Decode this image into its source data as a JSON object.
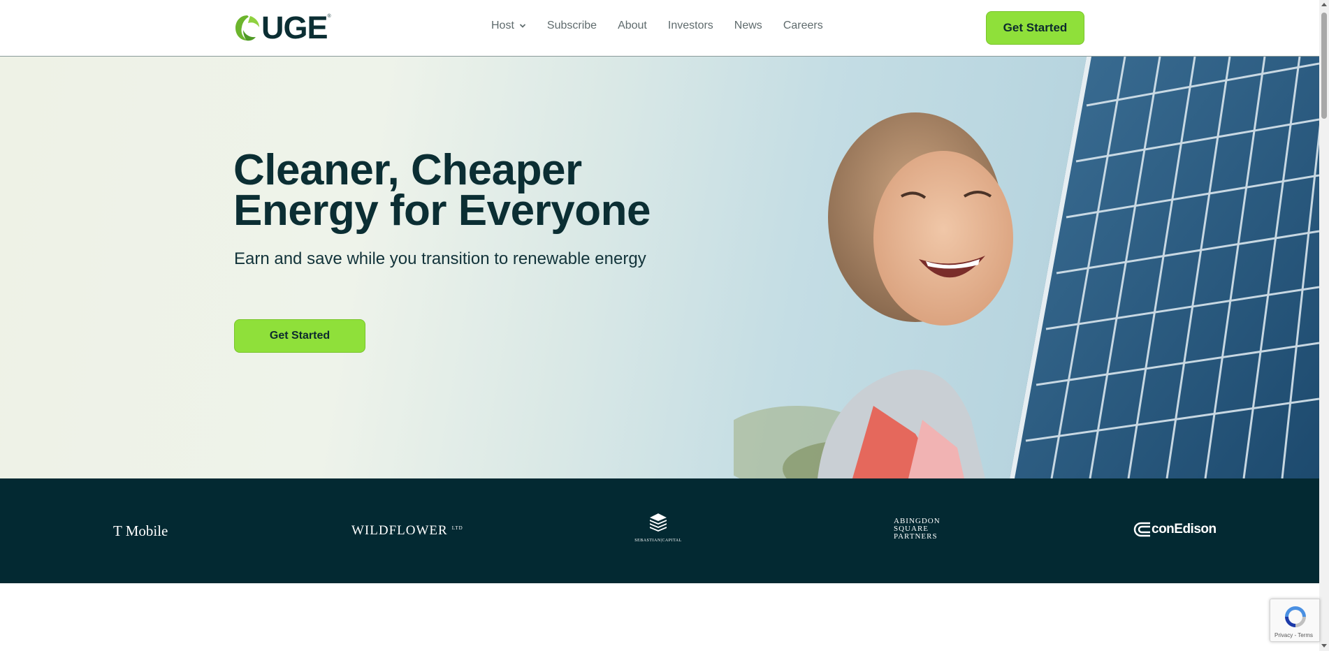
{
  "header": {
    "logo_text": "UGE",
    "logo_reg": "®",
    "nav": [
      {
        "label": "Host",
        "has_dropdown": true
      },
      {
        "label": "Subscribe"
      },
      {
        "label": "About"
      },
      {
        "label": "Investors"
      },
      {
        "label": "News"
      },
      {
        "label": "Careers"
      }
    ],
    "cta_label": "Get Started"
  },
  "hero": {
    "title_line1": "Cleaner, Cheaper",
    "title_line2": "Energy for Everyone",
    "subtitle": "Earn and save while you transition to renewable energy",
    "cta_label": "Get Started"
  },
  "partners": {
    "logos": [
      {
        "name": "T Mobile",
        "text": "T Mobile"
      },
      {
        "name": "Wildflower",
        "text": "WILDFLOWER",
        "suffix": "LTD"
      },
      {
        "name": "Sebastian Capital",
        "text": "SEBASTIAN|CAPITAL"
      },
      {
        "name": "Abingdon Square Partners",
        "lines": [
          "ABINGDON",
          "SQUARE",
          "PARTNERS"
        ]
      },
      {
        "name": "conEdison",
        "text": "conEdison"
      }
    ]
  },
  "recaptcha": {
    "privacy": "Privacy",
    "separator": " - ",
    "terms": "Terms"
  },
  "colors": {
    "brand_dark": "#0b2e33",
    "accent_green": "#8fe03a",
    "partners_bg": "#032932"
  }
}
